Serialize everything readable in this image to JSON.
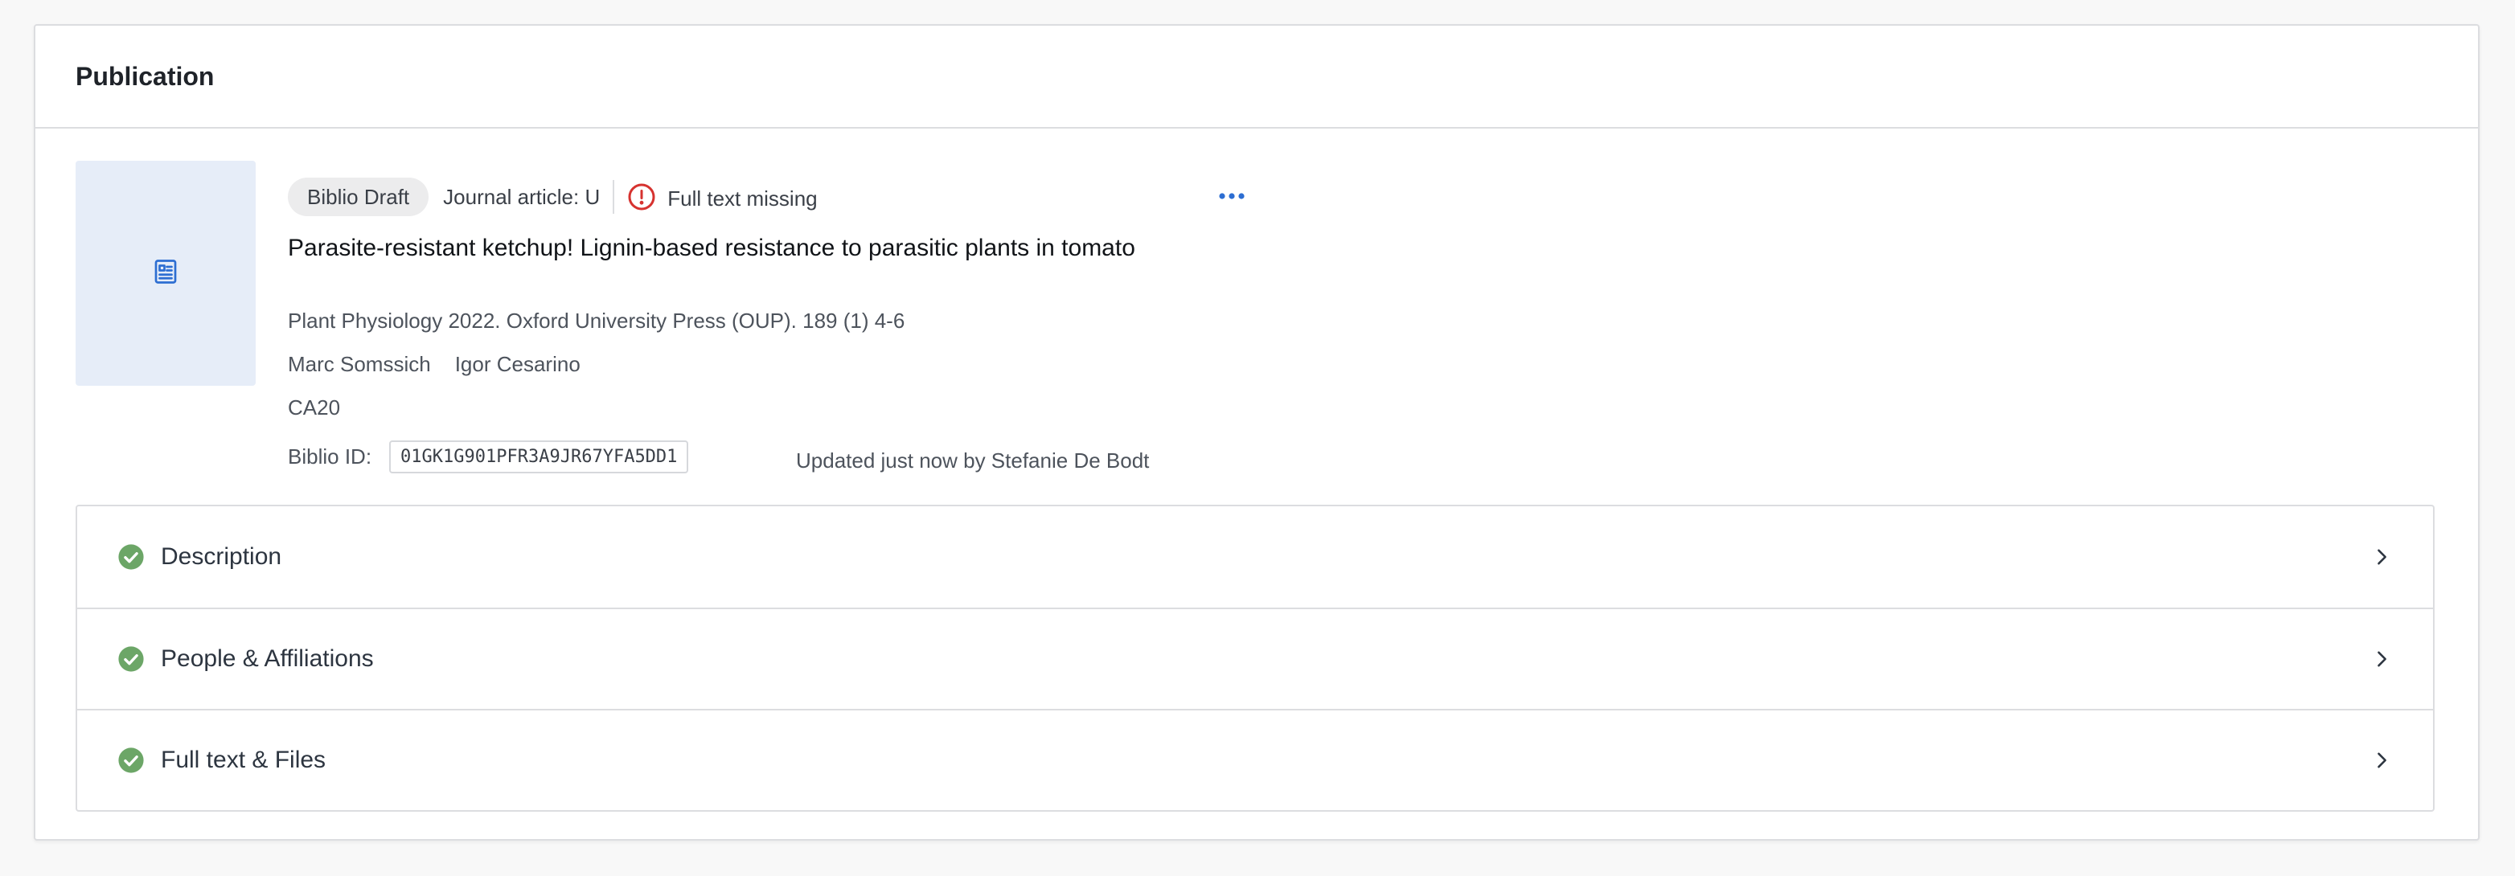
{
  "card": {
    "title": "Publication"
  },
  "publication": {
    "status_badge": "Biblio Draft",
    "type": "Journal article: U",
    "warning": "Full text missing",
    "title": "Parasite-resistant ketchup! Lignin-based resistance to parasitic plants in tomato",
    "citation": "Plant Physiology 2022. Oxford University Press (OUP). 189 (1) 4-6",
    "authors": [
      "Marc Somssich",
      "Igor Cesarino"
    ],
    "department": "CA20",
    "biblio_id_label": "Biblio ID:",
    "biblio_id": "01GK1G901PFR3A9JR67YFA5DD1",
    "updated": "Updated just now by Stefanie De Bodt"
  },
  "sections": [
    {
      "label": "Description",
      "status": "complete"
    },
    {
      "label": "People & Affiliations",
      "status": "complete"
    },
    {
      "label": "Full text & Files",
      "status": "complete"
    }
  ],
  "colors": {
    "accent": "#2d6ed2",
    "success": "#6ca667",
    "warning": "#d6322f",
    "thumb_bg": "#e6edf8"
  },
  "icons": {
    "thumbnail": "document-icon",
    "warning": "alert-circle-icon",
    "more": "more-horizontal-icon",
    "section_status": "check-circle-icon",
    "section_chevron": "chevron-right-icon"
  }
}
